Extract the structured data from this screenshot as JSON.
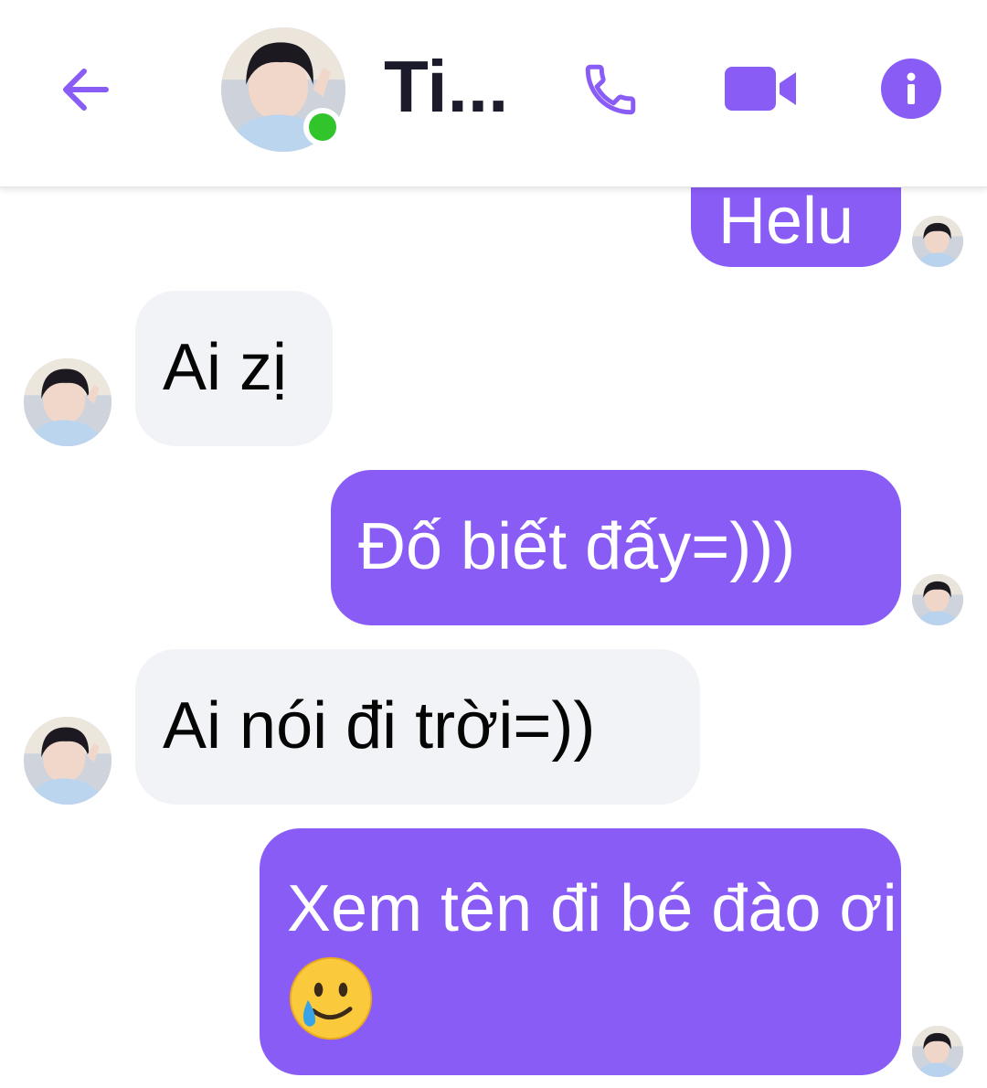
{
  "header": {
    "contact_name": "Ti...",
    "status": "online",
    "icons": [
      "back-arrow-icon",
      "phone-icon",
      "video-camera-icon",
      "info-icon"
    ]
  },
  "messages": [
    {
      "direction": "outgoing",
      "text": "Helu"
    },
    {
      "direction": "incoming",
      "text": "Ai zị"
    },
    {
      "direction": "outgoing",
      "text": "Đố biết đấy=)))"
    },
    {
      "direction": "incoming",
      "text": "Ai nói đi trời=))"
    },
    {
      "direction": "outgoing",
      "text": "Xem tên đi bé đào ơi",
      "emoji": "smiling-face-with-tear"
    }
  ],
  "colors": {
    "accent": "#8a5cf6",
    "incoming_bubble": "#f2f3f6",
    "online": "#31c42b",
    "name_text": "#1b1b2b"
  }
}
